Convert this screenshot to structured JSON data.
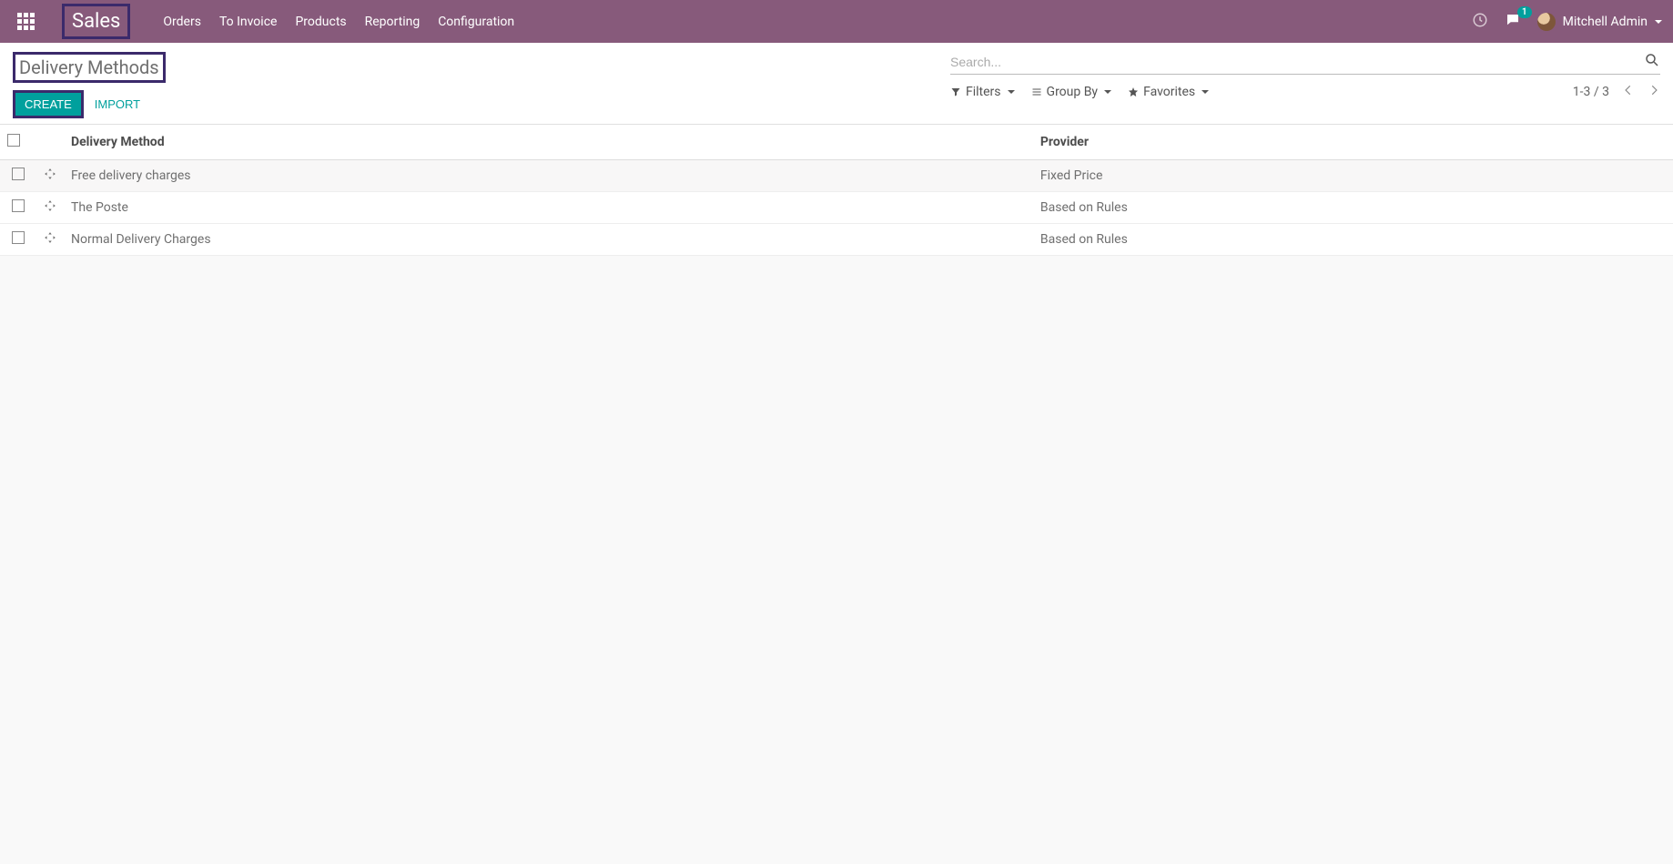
{
  "topbar": {
    "brand": "Sales",
    "menu": [
      "Orders",
      "To Invoice",
      "Products",
      "Reporting",
      "Configuration"
    ],
    "messages_badge": "1",
    "user_name": "Mitchell Admin"
  },
  "control_panel": {
    "title": "Delivery Methods",
    "create_label": "CREATE",
    "import_label": "IMPORT",
    "search_placeholder": "Search...",
    "filters_label": "Filters",
    "groupby_label": "Group By",
    "favorites_label": "Favorites",
    "pager_text": "1-3 / 3"
  },
  "table": {
    "columns": {
      "method": "Delivery Method",
      "provider": "Provider"
    },
    "rows": [
      {
        "method": "Free delivery charges",
        "provider": "Fixed Price"
      },
      {
        "method": "The Poste",
        "provider": "Based on Rules"
      },
      {
        "method": "Normal Delivery Charges",
        "provider": "Based on Rules"
      }
    ]
  }
}
